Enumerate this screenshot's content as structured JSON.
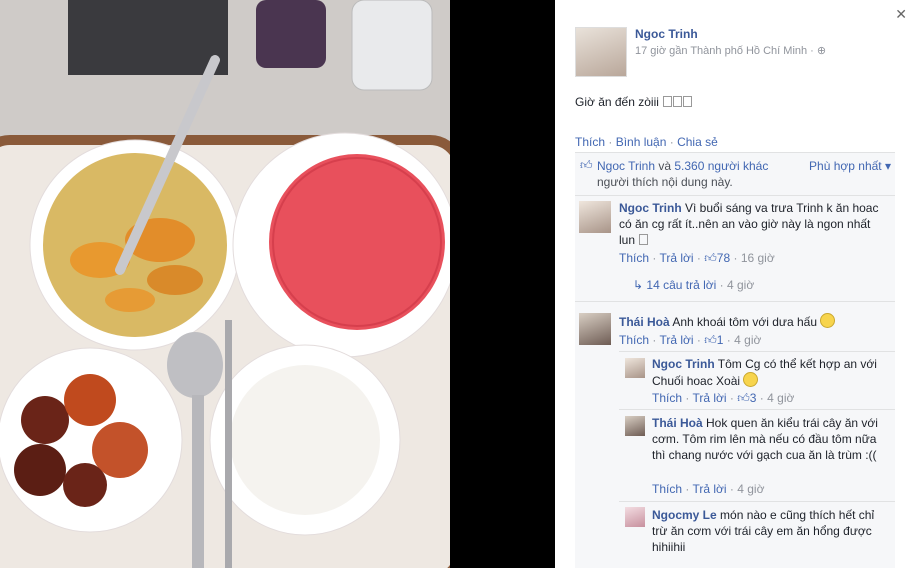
{
  "post": {
    "author": "Ngoc Trinh",
    "meta": "17 giờ gần Thành phố Hồ Chí Minh · ⊕",
    "text": "Giờ ăn đến zòiii"
  },
  "actions": {
    "like": "Thích",
    "comment": "Bình luận",
    "share": "Chia sẻ",
    "sep": " · "
  },
  "likes": {
    "name": "Ngoc Trinh",
    "and": " và ",
    "others": "5.360 người khác",
    "line2": "người thích nội dung này.",
    "sort": "Phù hợp nhất ▾"
  },
  "comments": [
    {
      "name": "Ngoc Trinh",
      "text": " Vì buổi sáng va trưa Trinh k ăn hoac có ăn cg rất ít..nên an vào giờ này là ngon nhất lun",
      "like": "Thích",
      "reply": "Trả lời",
      "likes": "78",
      "time": "16 giờ",
      "replies_link": "14 câu trả lời",
      "replies_time": "4 giờ"
    },
    {
      "name": "Thái Hoà",
      "text": " Anh khoái tôm với dưa hấu",
      "like": "Thích",
      "reply": "Trả lời",
      "likes": "1",
      "time": "4 giờ"
    }
  ],
  "replies": [
    {
      "name": "Ngoc Trinh",
      "text": " Tôm Cg có thể kết hợp an với Chuối hoac Xoài",
      "like": "Thích",
      "reply": "Trả lời",
      "likes": "3",
      "time": "4 giờ"
    },
    {
      "name": "Thái Hoà",
      "text": " Hok quen ăn kiểu trái cây ăn với cơm. Tôm rim lên mà nếu có đầu tôm nữa thì chang nước với gạch cua ăn là trùm :((",
      "like": "Thích",
      "reply": "Trả lời",
      "time": "4 giờ"
    },
    {
      "name": "Ngocmy Le",
      "text": " món nào e cũng thích hết chỉ trừ ăn cơm với trái cây em ăn hổng được hihiihii"
    }
  ],
  "icons": {
    "close": "close-icon",
    "like": "thumbs-up-icon",
    "reply_arrow": "reply-arrow-icon",
    "emoji": "smiley-icon"
  },
  "colors": {
    "link": "#4267b2",
    "name": "#3b5998",
    "meta": "#90949c"
  }
}
